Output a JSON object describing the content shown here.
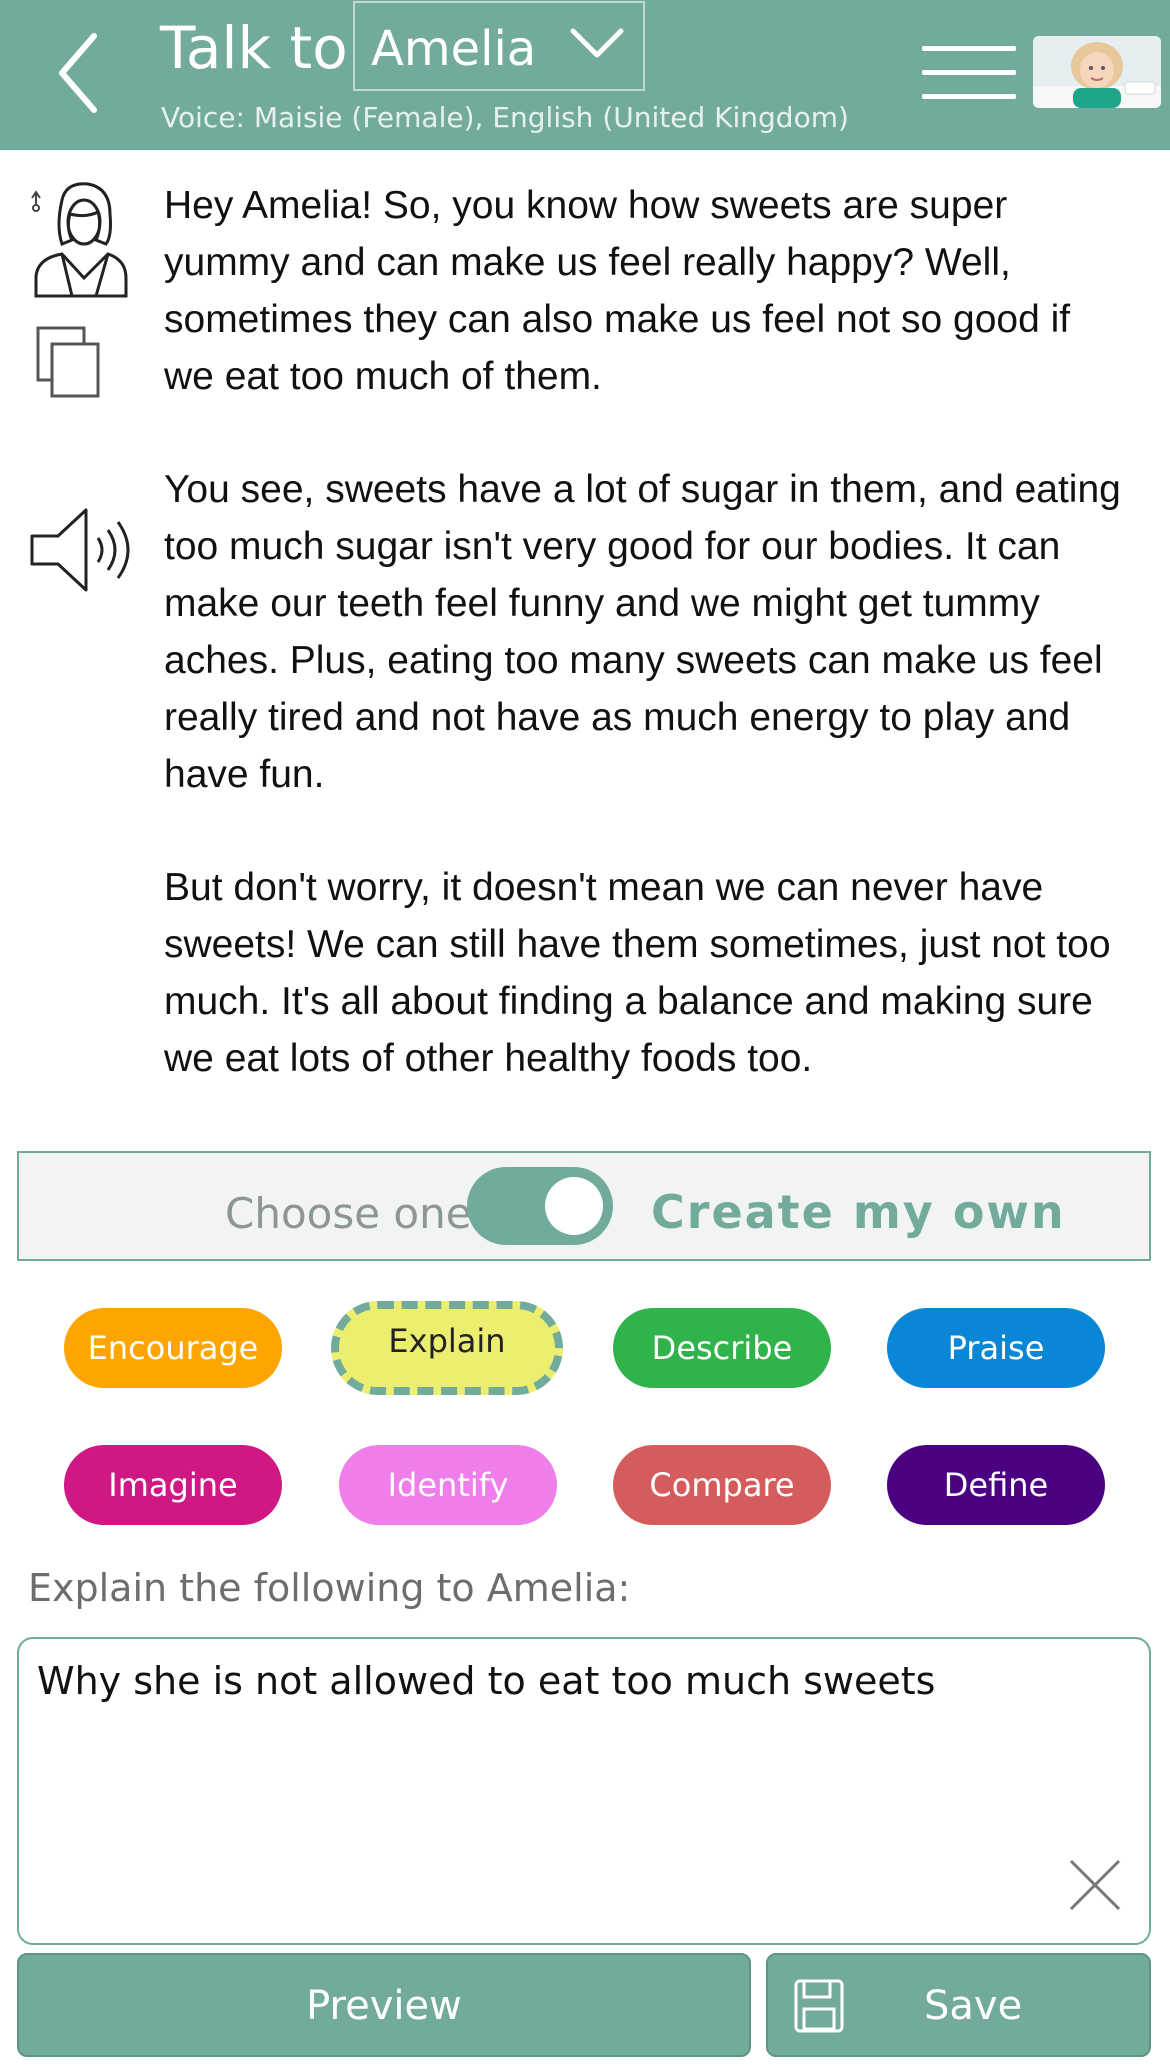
{
  "header": {
    "title": "Talk to",
    "selected_name": "Amelia",
    "voice": "Voice: Maisie (Female), English (United Kingdom)",
    "icons": {
      "back": "back-arrow-icon",
      "dropdown": "chevron-down-icon",
      "menu": "hamburger-menu-icon",
      "avatar": "child-avatar"
    }
  },
  "message": {
    "paragraphs": [
      "Hey Amelia! So, you know how sweets are super yummy and can make us feel really happy? Well, sometimes they can also make us feel not so good if we eat too much of them.",
      "You see, sweets have a lot of sugar in them, and eating too much sugar isn't very good for our bodies. It can make our teeth feel funny and we might get tummy aches. Plus, eating too many sweets can make us feel really tired and not have as much energy to play and have fun.",
      "But don't worry, it doesn't mean we can never have sweets! We can still have them sometimes, just not too much. It's all about finding a balance and making sure we eat lots of other healthy foods too."
    ],
    "icons": {
      "speaker_avatar": "teacher-avatar-icon",
      "copy": "copy-icon",
      "play_audio": "speaker-icon"
    }
  },
  "mode": {
    "left_label": "Choose one",
    "right_label": "Create my own",
    "toggle_on": true
  },
  "chips": [
    {
      "label": "Encourage",
      "color": "#ffa500"
    },
    {
      "label": "Explain",
      "color": "#ecee6f",
      "selected": true
    },
    {
      "label": "Describe",
      "color": "#2fb34a"
    },
    {
      "label": "Praise",
      "color": "#0a86d6"
    },
    {
      "label": "Imagine",
      "color": "#cf1884"
    },
    {
      "label": "Identify",
      "color": "#f07eea"
    },
    {
      "label": "Compare",
      "color": "#d55c5c"
    },
    {
      "label": "Define",
      "color": "#4a0080"
    }
  ],
  "prompt": {
    "label": "Explain the following to Amelia:",
    "value": "Why she is not allowed to eat too much sweets"
  },
  "actions": {
    "preview": "Preview",
    "save": "Save"
  },
  "colors": {
    "accent": "#72ab9b",
    "panel": "#f1f4f3"
  }
}
